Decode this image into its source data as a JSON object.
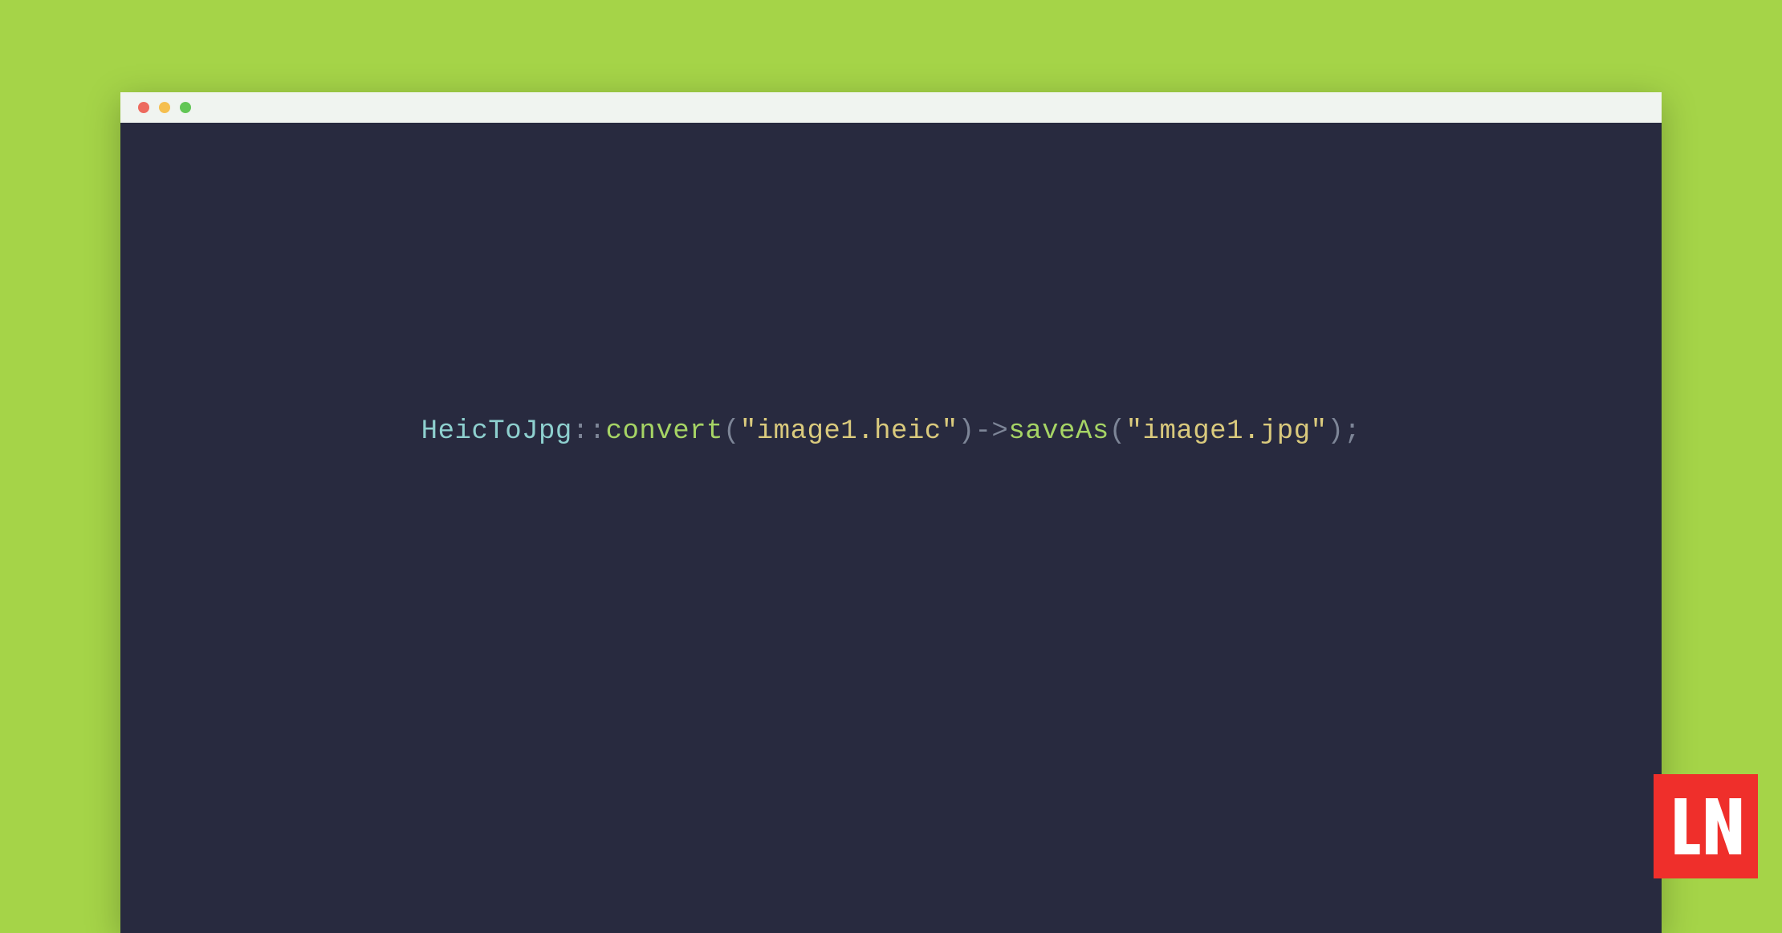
{
  "colors": {
    "background": "#a5d448",
    "editor_bg": "#282a3f",
    "titlebar_bg": "#f0f4f0",
    "logo_bg": "#ef2f2b",
    "syntax": {
      "class": "#8ed0cf",
      "operator": "#7d8597",
      "method": "#a6d465",
      "punct": "#7d8597",
      "string": "#daca7d"
    }
  },
  "traffic_lights": [
    "close",
    "minimize",
    "maximize"
  ],
  "code": {
    "class": "HeicToJpg",
    "scope": "::",
    "method1": "convert",
    "open1": "(",
    "string1": "\"image1.heic\"",
    "close1": ")",
    "arrow": "->",
    "method2": "saveAs",
    "open2": "(",
    "string2": "\"image1.jpg\"",
    "close2": ")",
    "semi": ";"
  },
  "logo": {
    "letters": "LN"
  }
}
